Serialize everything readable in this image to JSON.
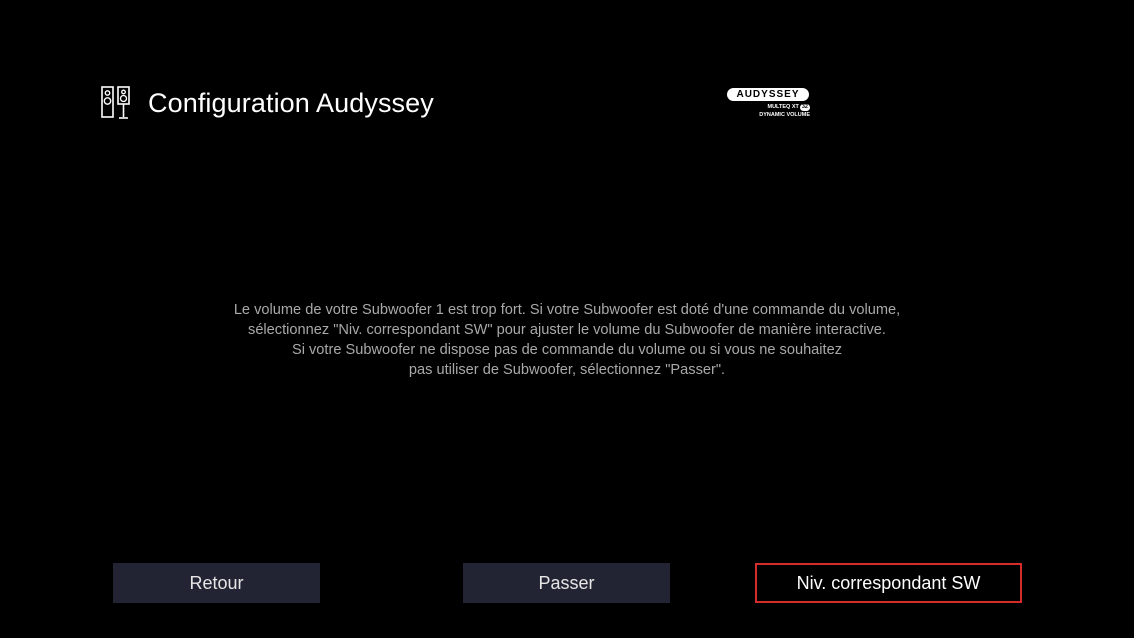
{
  "header": {
    "icon": "speaker-pair-icon",
    "title": "Configuration Audyssey"
  },
  "logo": {
    "brand": "AUDYSSEY",
    "line2": "MULTEQ XT",
    "line2_badge": "32",
    "line3": "DYNAMIC VOLUME"
  },
  "message": {
    "lines": [
      "Le volume de votre Subwoofer 1 est trop fort. Si votre Subwoofer est doté d'une commande du volume,",
      "sélectionnez \"Niv. correspondant SW\" pour ajuster le volume du Subwoofer de manière interactive.",
      "Si votre Subwoofer ne dispose pas de commande du volume ou si vous ne souhaitez",
      "pas utiliser de Subwoofer, sélectionnez \"Passer\"."
    ]
  },
  "buttons": {
    "back": "Retour",
    "skip": "Passer",
    "match": "Niv. correspondant SW"
  },
  "colors": {
    "background": "#000000",
    "button_bg": "#232433",
    "focus_border": "#d62b2b",
    "message_text": "#a9a9a9"
  }
}
